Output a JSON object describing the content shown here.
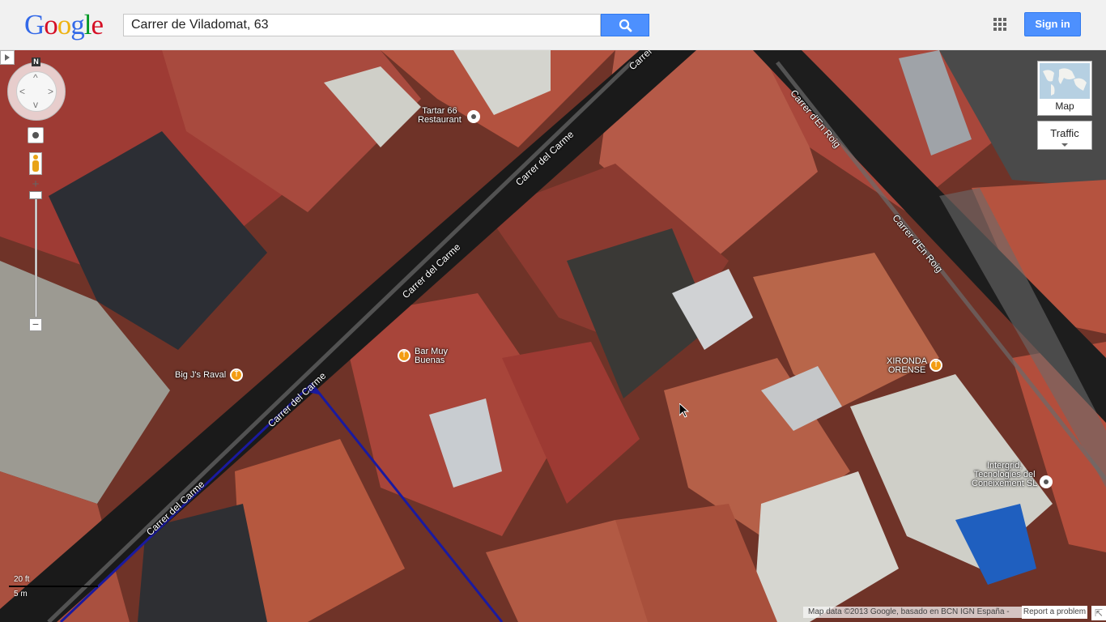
{
  "header": {
    "logo_letters": [
      "G",
      "o",
      "o",
      "g",
      "l",
      "e"
    ],
    "search_value": "Carrer de Viladomat, 63",
    "sign_in_label": "Sign in"
  },
  "icons": {
    "search": "search-icon",
    "apps": "apps-grid-icon",
    "compass": "compass-icon",
    "pegman": "pegman-icon",
    "restaurant": "restaurant-icon",
    "place": "place-dot-icon"
  },
  "map": {
    "view": "satellite",
    "streets": [
      "Carrer del Carme",
      "Carrer del Carme",
      "Carrer del Carme",
      "Carrer del Carme",
      "Carrer del Carme",
      "Carrer d'En Roig",
      "Carrer d'En Roig"
    ],
    "places": [
      {
        "name_lines": [
          "Tartar 66",
          "Restaurant"
        ],
        "type": "place"
      },
      {
        "name_lines": [
          "Bar Muy",
          "Buenas"
        ],
        "type": "restaurant"
      },
      {
        "name_lines": [
          "Big J's Raval"
        ],
        "type": "restaurant"
      },
      {
        "name_lines": [
          "XIRONDA",
          "ORENSE"
        ],
        "type": "restaurant"
      },
      {
        "name_lines": [
          "Intergrid,",
          "Tecnologies del",
          "Coneixement SL"
        ],
        "type": "place"
      }
    ]
  },
  "controls": {
    "compass_label": "N",
    "zoom_in": "+",
    "zoom_out": "−",
    "map_type_label": "Map",
    "traffic_label": "Traffic"
  },
  "scale": {
    "feet": "20 ft",
    "meters": "5 m"
  },
  "footer": {
    "attribution": "Map data ©2013 Google, basado en BCN IGN España -",
    "report": "Report a problem"
  },
  "colors": {
    "roof": "#a8453a",
    "road": "#1a1a1a",
    "route": "#1a1aa0",
    "button_blue": "#4d90fe"
  }
}
